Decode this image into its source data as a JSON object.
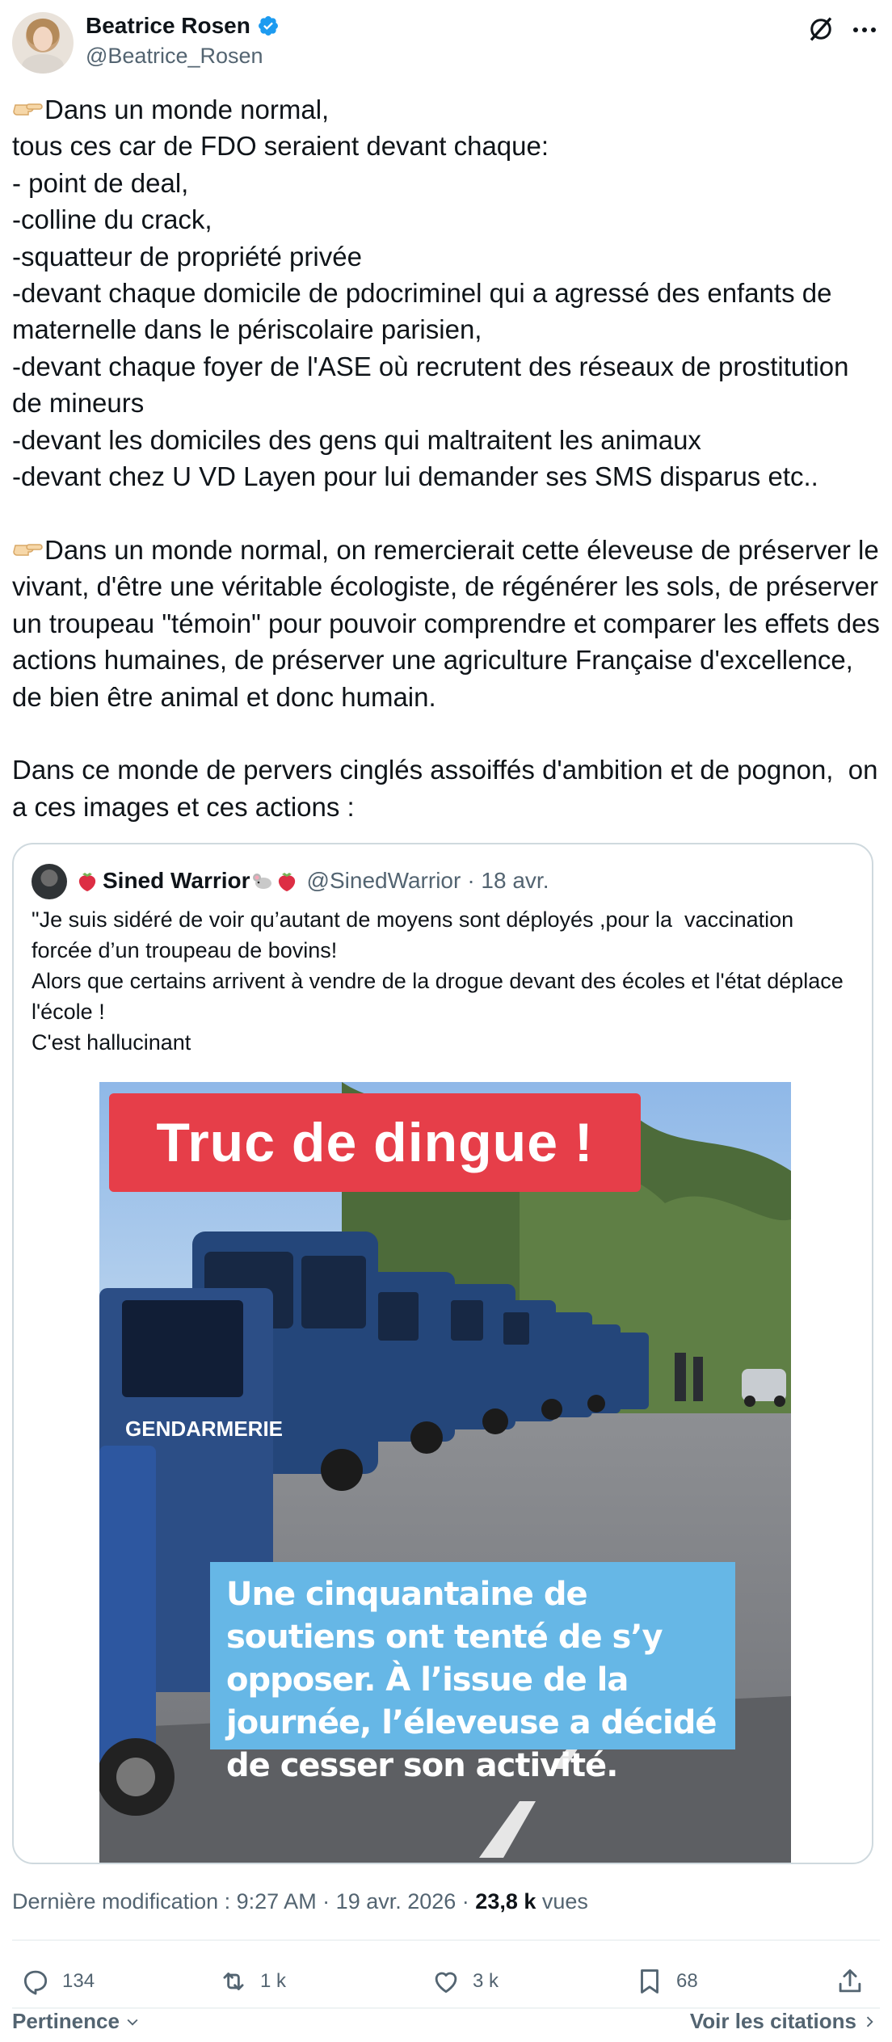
{
  "author": {
    "name": "Beatrice Rosen",
    "handle": "@Beatrice_Rosen"
  },
  "tweet": {
    "para1_line1": "Dans un monde normal,",
    "para1_rest": "tous ces car de FDO seraient devant chaque:\n- point de deal,\n-colline du crack,\n-squatteur de propriété privée\n-devant chaque domicile de pdocriminel qui a agressé des enfants de maternelle dans le périscolaire parisien,\n-devant chaque foyer de l'ASE où recrutent des réseaux de prostitution de mineurs\n-devant les domiciles des gens qui maltraitent les animaux\n-devant chez U VD Layen pour lui demander ses SMS disparus etc..",
    "para2": "Dans un monde normal, on remercierait cette éleveuse de préserver le vivant, d'être une véritable écologiste, de régénérer les sols, de préserver un troupeau \"témoin\" pour pouvoir comprendre et comparer les effets des actions humaines, de préserver une agriculture Française d'excellence, de bien être animal et donc humain.",
    "para3": "Dans ce monde de pervers cinglés assoiffés d'ambition et de pognon,  on a ces images et ces actions :"
  },
  "quote": {
    "name": "Sined Warrior",
    "handle": "@SinedWarrior",
    "date": "· 18 avr.",
    "text": "\"Je suis sidéré de voir qu’autant de moyens sont déployés ,pour la  vaccination forcée d’un troupeau de bovins!\nAlors que certains arrivent à vendre de la drogue devant des écoles et l'état déplace l'école !\nC'est hallucinant",
    "image": {
      "banner": "Truc de dingue !",
      "caption": "Une cinquantaine de soutiens ont tenté de s’y opposer. À l’issue de la journée, l’éleveuse a décidé de cesser son activité.",
      "vehicle_label": "GENDARMERIE"
    }
  },
  "meta": {
    "prefix": "Dernière modification : 9:27 AM · 19 avr. 2026 · ",
    "views_count": "23,8 k",
    "views_label": " vues"
  },
  "actions": {
    "replies": "134",
    "reposts": "1 k",
    "likes": "3 k",
    "bookmarks": "68"
  },
  "footer": {
    "sort_label": "Pertinence",
    "quotes_link": "Voir les citations"
  },
  "colors": {
    "verified": "#1d9bf0",
    "secondary_text": "#536471",
    "border": "#cfd9de",
    "banner": "#e63e49",
    "caption": "#66b7e6"
  },
  "icons": [
    "pointing-right-icon",
    "verified-badge-icon",
    "grok-icon",
    "more-icon",
    "strawberry-icon",
    "mouse-icon",
    "reply-icon",
    "repost-icon",
    "like-icon",
    "bookmark-icon",
    "share-icon",
    "chevron-down-icon",
    "chevron-right-icon"
  ]
}
